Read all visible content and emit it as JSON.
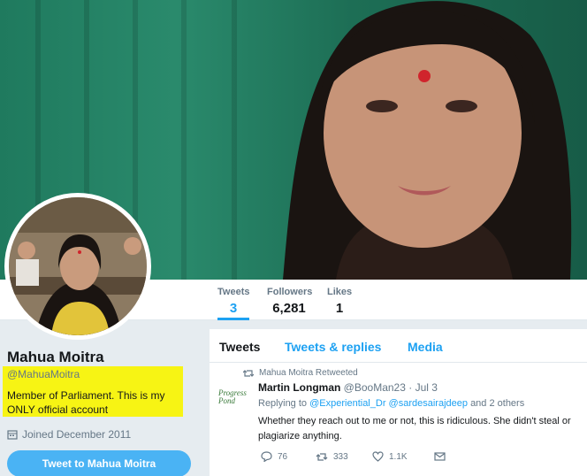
{
  "profile": {
    "name": "Mahua Moitra",
    "handle": "@MahuaMoitra",
    "bio": "Member of Parliament. This is my ONLY official account",
    "joined": "Joined December 2011",
    "tweet_to_label": "Tweet to Mahua Moitra"
  },
  "stats": [
    {
      "label": "Tweets",
      "value": "3"
    },
    {
      "label": "Followers",
      "value": "6,281"
    },
    {
      "label": "Likes",
      "value": "1"
    }
  ],
  "tabs": [
    "Tweets",
    "Tweets & replies",
    "Media"
  ],
  "tweet": {
    "retweeted_by": "Mahua Moitra Retweeted",
    "author_name": "Martin Longman",
    "author_handle": "@BooMan23",
    "time": "· Jul 3",
    "replying_prefix": "Replying to",
    "reply_user1": "@Experiential_Dr",
    "reply_user2": "@sardesairajdeep",
    "reply_suffix": "and 2 others",
    "text": "Whether they reach out to me or not, this is ridiculous. She didn't steal or plagiarize anything.",
    "replies": "76",
    "retweets": "333",
    "likes": "1.1K",
    "avatar_text": "Progress Pond"
  },
  "colors": {
    "accent": "#1da1f2",
    "highlight": "#f7f414",
    "banner": "#1f7a5e"
  }
}
